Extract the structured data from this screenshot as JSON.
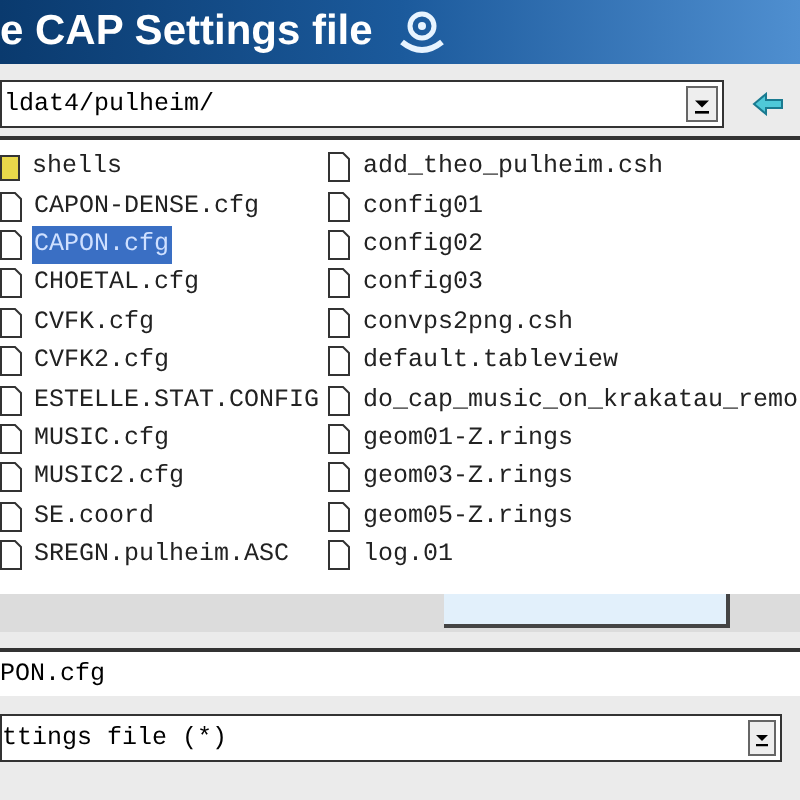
{
  "window": {
    "title": "e CAP Settings file"
  },
  "path": {
    "value": "ldat4/pulheim/"
  },
  "files": {
    "columns": [
      [
        {
          "name": "shells",
          "kind": "folder",
          "selected": false
        },
        {
          "name": "CAPON-DENSE.cfg",
          "kind": "file",
          "selected": false
        },
        {
          "name": "CAPON.cfg",
          "kind": "file",
          "selected": true
        },
        {
          "name": "CHOETAL.cfg",
          "kind": "file",
          "selected": false
        },
        {
          "name": "CVFK.cfg",
          "kind": "file",
          "selected": false
        },
        {
          "name": "CVFK2.cfg",
          "kind": "file",
          "selected": false
        },
        {
          "name": "ESTELLE.STAT.CONFIG",
          "kind": "file",
          "selected": false
        },
        {
          "name": "MUSIC.cfg",
          "kind": "file",
          "selected": false
        },
        {
          "name": "MUSIC2.cfg",
          "kind": "file",
          "selected": false
        },
        {
          "name": "SE.coord",
          "kind": "file",
          "selected": false
        },
        {
          "name": "SREGN.pulheim.ASC",
          "kind": "file",
          "selected": false
        }
      ],
      [
        {
          "name": "add_theo_pulheim.csh",
          "kind": "file",
          "selected": false
        },
        {
          "name": "config01",
          "kind": "file",
          "selected": false
        },
        {
          "name": "config02",
          "kind": "file",
          "selected": false
        },
        {
          "name": "config03",
          "kind": "file",
          "selected": false
        },
        {
          "name": "convps2png.csh",
          "kind": "file",
          "selected": false
        },
        {
          "name": "default.tableview",
          "kind": "file",
          "selected": false
        },
        {
          "name": "do_cap_music_on_krakatau_remo",
          "kind": "file",
          "selected": false
        },
        {
          "name": "geom01-Z.rings",
          "kind": "file",
          "selected": false
        },
        {
          "name": "geom03-Z.rings",
          "kind": "file",
          "selected": false
        },
        {
          "name": "geom05-Z.rings",
          "kind": "file",
          "selected": false
        },
        {
          "name": "log.01",
          "kind": "file",
          "selected": false
        }
      ]
    ]
  },
  "filename": {
    "value": "PON.cfg"
  },
  "filter": {
    "value": "ttings file (*)"
  }
}
